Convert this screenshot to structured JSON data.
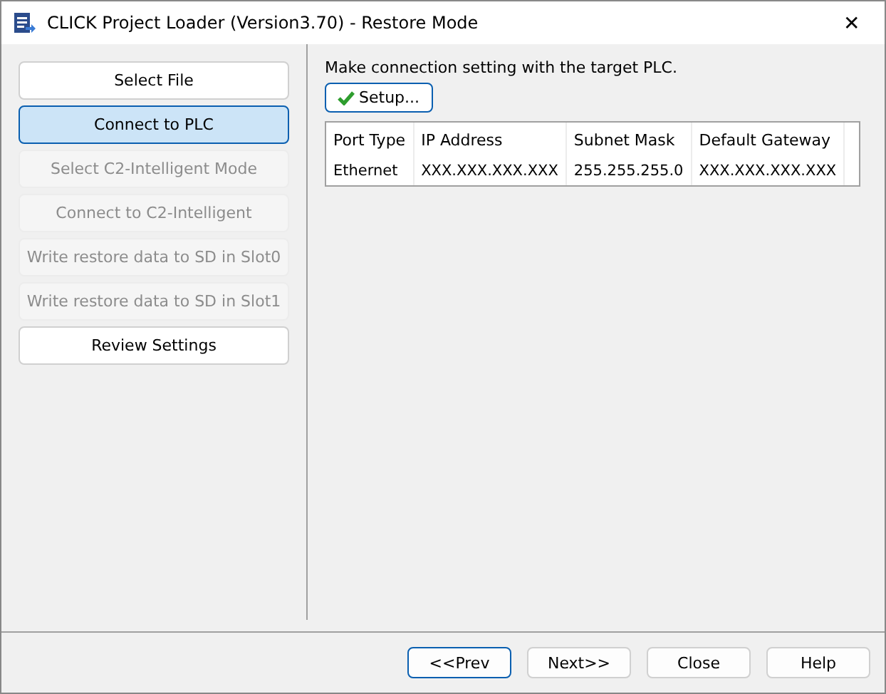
{
  "window": {
    "title": "CLICK Project Loader (Version3.70) - Restore Mode",
    "close": "✕"
  },
  "steps": [
    {
      "label": "Select File",
      "selected": false,
      "disabled": false
    },
    {
      "label": "Connect to PLC",
      "selected": true,
      "disabled": false
    },
    {
      "label": "Select C2-Intelligent Mode",
      "selected": false,
      "disabled": true
    },
    {
      "label": "Connect to C2-Intelligent",
      "selected": false,
      "disabled": true
    },
    {
      "label": "Write restore data to SD in Slot0",
      "selected": false,
      "disabled": true
    },
    {
      "label": "Write restore data to SD in Slot1",
      "selected": false,
      "disabled": true
    },
    {
      "label": "Review Settings",
      "selected": false,
      "disabled": false
    }
  ],
  "instruction": "Make connection setting with the target PLC.",
  "setup_button": "Setup...",
  "table": {
    "columns": [
      "Port Type",
      "IP Address",
      "Subnet Mask",
      "Default Gateway"
    ],
    "rows": [
      [
        "Ethernet",
        "XXX.XXX.XXX.XXX",
        "255.255.255.0",
        "XXX.XXX.XXX.XXX"
      ]
    ]
  },
  "buttons": [
    {
      "label": "<<Prev",
      "default": true
    },
    {
      "label": "Next>>",
      "default": false
    },
    {
      "label": "Close",
      "default": false
    },
    {
      "label": "Help",
      "default": false
    }
  ]
}
